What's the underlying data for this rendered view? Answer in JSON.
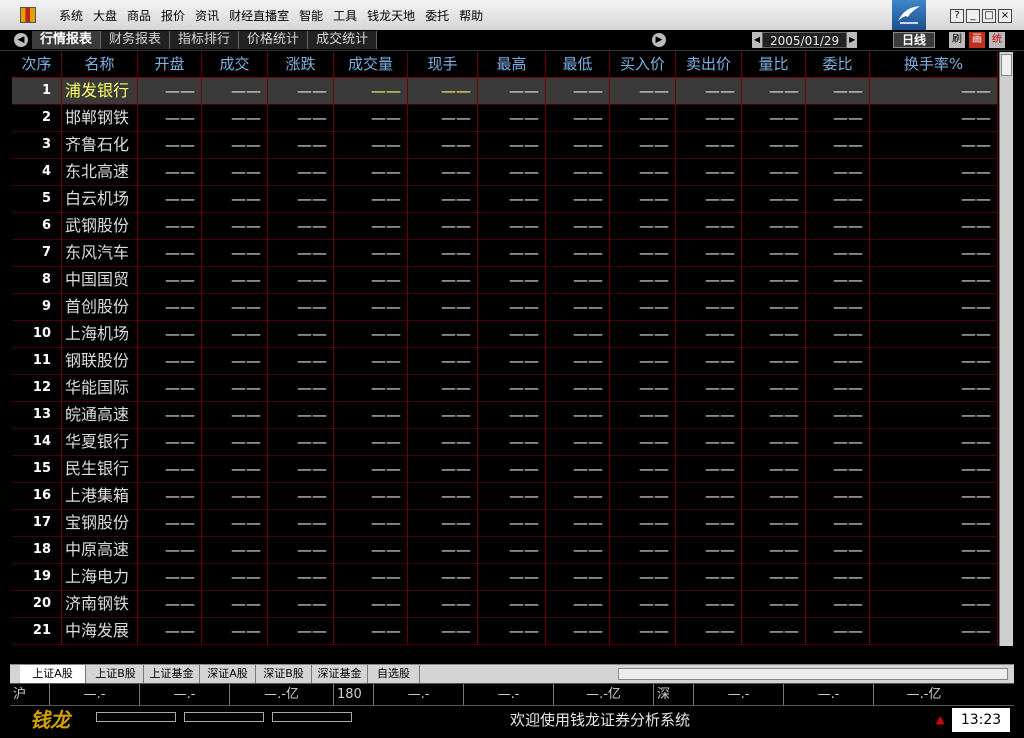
{
  "menubar": {
    "items": [
      "系统",
      "大盘",
      "商品",
      "报价",
      "资讯",
      "财经直播室",
      "智能",
      "工具",
      "钱龙天地",
      "委托",
      "帮助"
    ]
  },
  "tabs": [
    "行情报表",
    "财务报表",
    "指标排行",
    "价格统计",
    "成交统计"
  ],
  "date": "2005/01/29",
  "period": "日线",
  "toolbar_icons": [
    "刷",
    "画",
    "统"
  ],
  "columns": [
    "次序",
    "名称",
    "开盘",
    "成交",
    "涨跌",
    "成交量",
    "现手",
    "最高",
    "最低",
    "买入价",
    "卖出价",
    "量比",
    "委比",
    "换手率%"
  ],
  "placeholder": "——",
  "rows": [
    {
      "idx": "1",
      "name": "浦发银行"
    },
    {
      "idx": "2",
      "name": "邯郸钢铁"
    },
    {
      "idx": "3",
      "name": "齐鲁石化"
    },
    {
      "idx": "4",
      "name": "东北高速"
    },
    {
      "idx": "5",
      "name": "白云机场"
    },
    {
      "idx": "6",
      "name": "武钢股份"
    },
    {
      "idx": "7",
      "name": "东风汽车"
    },
    {
      "idx": "8",
      "name": "中国国贸"
    },
    {
      "idx": "9",
      "name": "首创股份"
    },
    {
      "idx": "10",
      "name": "上海机场"
    },
    {
      "idx": "11",
      "name": "钢联股份"
    },
    {
      "idx": "12",
      "name": "华能国际"
    },
    {
      "idx": "13",
      "name": "皖通高速"
    },
    {
      "idx": "14",
      "name": "华夏银行"
    },
    {
      "idx": "15",
      "name": "民生银行"
    },
    {
      "idx": "16",
      "name": "上港集箱"
    },
    {
      "idx": "17",
      "name": "宝钢股份"
    },
    {
      "idx": "18",
      "name": "中原高速"
    },
    {
      "idx": "19",
      "name": "上海电力"
    },
    {
      "idx": "20",
      "name": "济南钢铁"
    },
    {
      "idx": "21",
      "name": "中海发展"
    }
  ],
  "sheets": [
    "上证A股",
    "上证B股",
    "上证基金",
    "深证A股",
    "深证B股",
    "深证基金",
    "自选股"
  ],
  "index_strip": {
    "sh_label": "沪",
    "sh_values": [
      "—.-",
      "—.-",
      "—.-亿"
    ],
    "s180_label": "180",
    "s180_values": [
      "—.-",
      "—.-",
      "—.-亿"
    ],
    "sz_label": "深",
    "sz_values": [
      "—.-",
      "—.-",
      "—.-亿"
    ]
  },
  "status": {
    "brand": "钱龙",
    "welcome": "欢迎使用钱龙证券分析系统",
    "time": "13:23"
  },
  "colors": {
    "header_text": "#7fb0e0",
    "grid_line": "#6a0000",
    "selected_name": "#ffff66"
  }
}
